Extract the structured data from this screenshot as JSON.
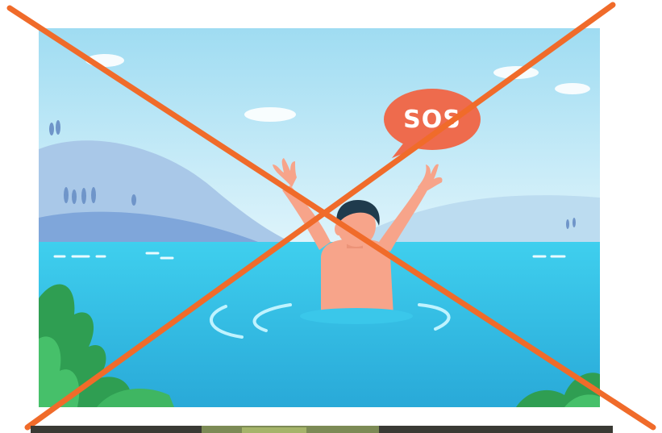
{
  "illustration": {
    "speech_bubble_text": "SOS",
    "colors": {
      "sky": "#c9ecf7",
      "sea": "#33c3e6",
      "bubble": "#ee6b4d",
      "cross": "#f06b2a",
      "skin": "#f7a48a",
      "hair": "#1f3b4d",
      "foliage": "#2f9e52"
    }
  }
}
